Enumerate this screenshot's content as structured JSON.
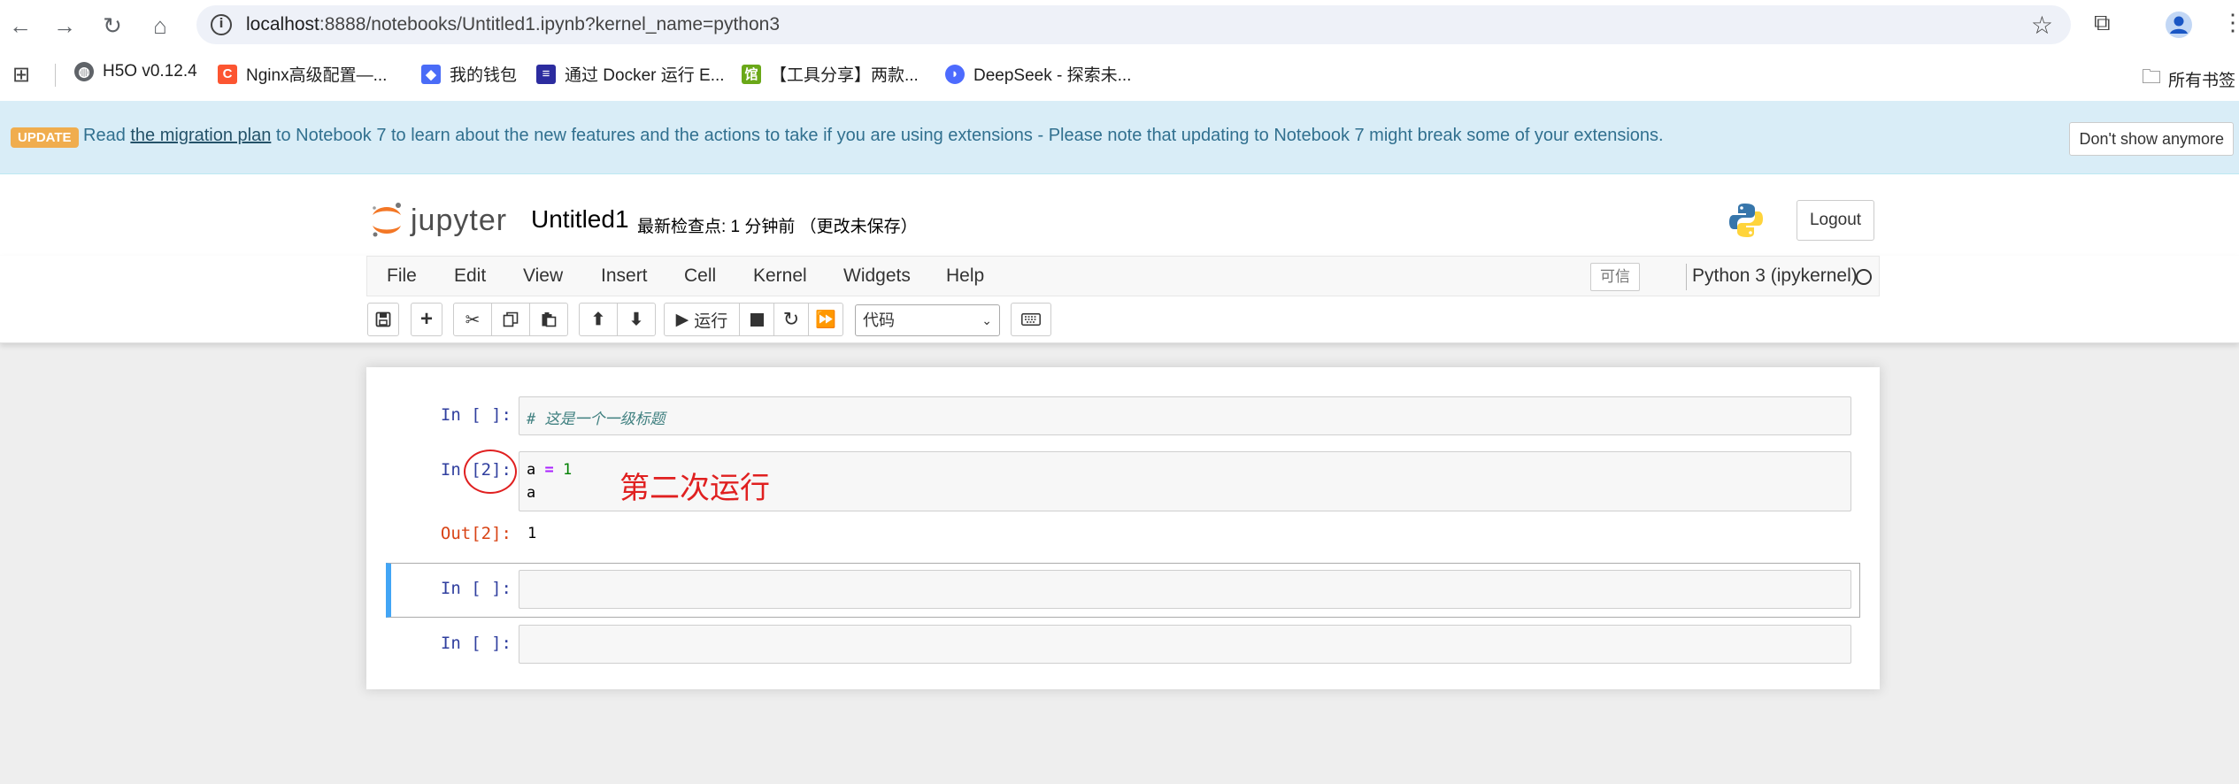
{
  "browser": {
    "url_host": "localhost",
    "url_rest": ":8888/notebooks/Untitled1.ipynb?kernel_name=python3",
    "bookmarks": [
      {
        "label": "H5O v0.12.4",
        "icon": "globe-icon",
        "color": "#5f6368"
      },
      {
        "label": "Nginx高级配置—...",
        "icon": "c-logo-icon",
        "color": "#fc5531"
      },
      {
        "label": "我的钱包",
        "icon": "wallet-icon",
        "color": "#4a6cf7"
      },
      {
        "label": "通过 Docker 运行 E...",
        "icon": "doc-icon",
        "color": "#2c2c9f"
      },
      {
        "label": "【工具分享】两款...",
        "icon": "site-icon",
        "color": "#6aa818"
      },
      {
        "label": "DeepSeek - 探索未...",
        "icon": "deepseek-icon",
        "color": "#4d6bfe"
      }
    ],
    "all_bookmarks_label": "所有书签"
  },
  "banner": {
    "badge": "UPDATE",
    "pre": "Read ",
    "link": "the migration plan",
    "post": " to Notebook 7 to learn about the new features and the actions to take if you are using extensions - Please note that updating to Notebook 7 might break some of your extensions.",
    "dismiss": "Don't show anymore"
  },
  "header": {
    "logo_text": "jupyter",
    "notebook_name": "Untitled1",
    "checkpoint": "最新检查点: 1 分钟前   （更改未保存）",
    "logout": "Logout"
  },
  "menu": {
    "items": [
      "File",
      "Edit",
      "View",
      "Insert",
      "Cell",
      "Kernel",
      "Widgets",
      "Help"
    ],
    "trusted": "可信",
    "kernel": "Python 3 (ipykernel)"
  },
  "toolbar": {
    "run_label": "运行",
    "cell_type": "代码"
  },
  "cells": [
    {
      "prompt": "In [ ]:",
      "lines": [
        "# 这是一个一级标题"
      ]
    },
    {
      "prompt": "In [2]:",
      "lines": [
        "a = 1",
        "a"
      ],
      "output_prompt": "Out[2]:",
      "output": "1"
    },
    {
      "prompt": "In [ ]:",
      "lines": []
    },
    {
      "prompt": "In [ ]:",
      "lines": []
    }
  ],
  "annotation": "第二次运行",
  "colors": {
    "accent": "#42a5f5",
    "annotation": "#e02020",
    "banner": "#d9edf7"
  }
}
